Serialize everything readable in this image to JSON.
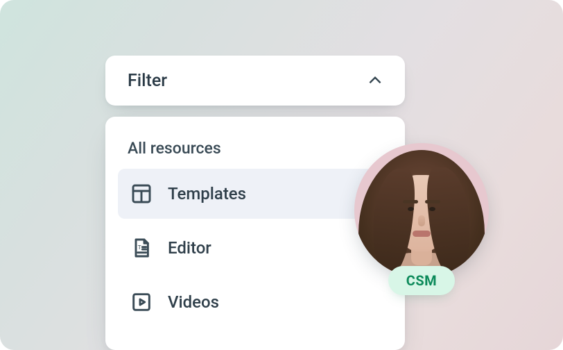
{
  "filter": {
    "label": "Filter",
    "expanded": true
  },
  "list": {
    "heading": "All resources",
    "items": [
      {
        "icon": "grid-icon",
        "label": "Templates",
        "selected": true
      },
      {
        "icon": "editor-doc-icon",
        "label": "Editor",
        "selected": false
      },
      {
        "icon": "video-icon",
        "label": "Videos",
        "selected": false
      }
    ]
  },
  "avatar": {
    "alt": "User portrait",
    "badge": "CSM"
  },
  "colors": {
    "badge_bg": "#d8f6e7",
    "badge_text": "#0c8a5a",
    "selected_bg": "#eef1f7"
  }
}
